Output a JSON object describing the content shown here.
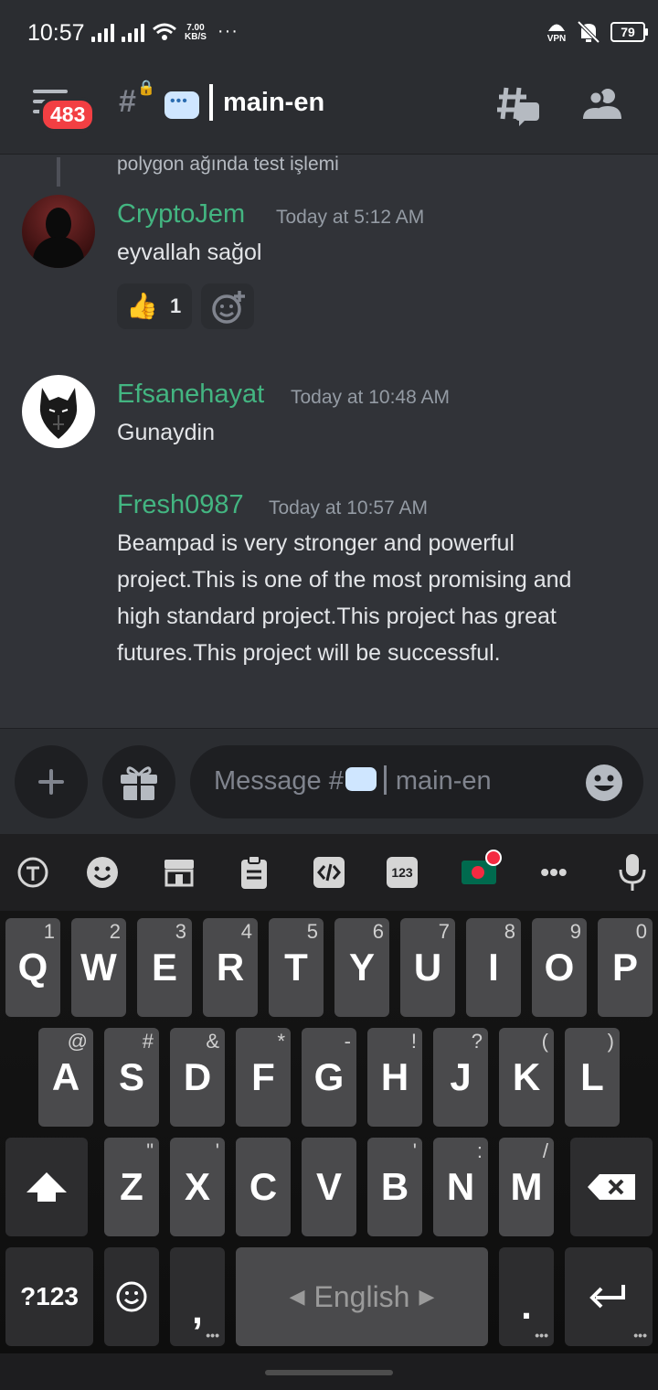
{
  "status_bar": {
    "time": "10:57",
    "speed_value": "7.00",
    "speed_unit": "KB/S",
    "overflow": "···",
    "vpn_label": "VPN",
    "battery": "79"
  },
  "header": {
    "unread_badge": "483",
    "channel_title": "main-en"
  },
  "messages": {
    "previous_snippet": "polygon ağında test işlemi",
    "items": [
      {
        "author": "CryptoJem",
        "timestamp": "Today at 5:12 AM",
        "text": "eyvallah sağol",
        "reaction_count": "1"
      },
      {
        "author": "Efsanehayat",
        "timestamp": "Today at 10:48 AM",
        "text": "Gunaydin"
      },
      {
        "author": "Fresh0987",
        "timestamp": "Today at 10:57 AM",
        "lines": [
          "Beampad is very stronger and powerful",
          "project.This is one of the most promising and",
          "high standard project.This project has great",
          "futures.This project will be successful."
        ]
      }
    ],
    "author_color": "#43b581"
  },
  "composer": {
    "placeholder_prefix": "Message #",
    "placeholder_channel": "main-en"
  },
  "keyboard": {
    "row1": [
      [
        "Q",
        "1"
      ],
      [
        "W",
        "2"
      ],
      [
        "E",
        "3"
      ],
      [
        "R",
        "4"
      ],
      [
        "T",
        "5"
      ],
      [
        "Y",
        "6"
      ],
      [
        "U",
        "7"
      ],
      [
        "I",
        "8"
      ],
      [
        "O",
        "9"
      ],
      [
        "P",
        "0"
      ]
    ],
    "row2": [
      [
        "A",
        "@"
      ],
      [
        "S",
        "#"
      ],
      [
        "D",
        "&"
      ],
      [
        "F",
        "*"
      ],
      [
        "G",
        "-"
      ],
      [
        "H",
        "!"
      ],
      [
        "J",
        "?"
      ],
      [
        "K",
        "("
      ],
      [
        "L",
        ")"
      ]
    ],
    "row3": [
      [
        "Z",
        "\""
      ],
      [
        "X",
        "'"
      ],
      [
        "C",
        ""
      ],
      [
        "V",
        ""
      ],
      [
        "B",
        "'"
      ],
      [
        "N",
        ":"
      ],
      [
        "M",
        "/"
      ]
    ],
    "symbols_key": "?123",
    "comma": ",",
    "period": ".",
    "space_label": "English",
    "toolbar_numbers": "123"
  }
}
